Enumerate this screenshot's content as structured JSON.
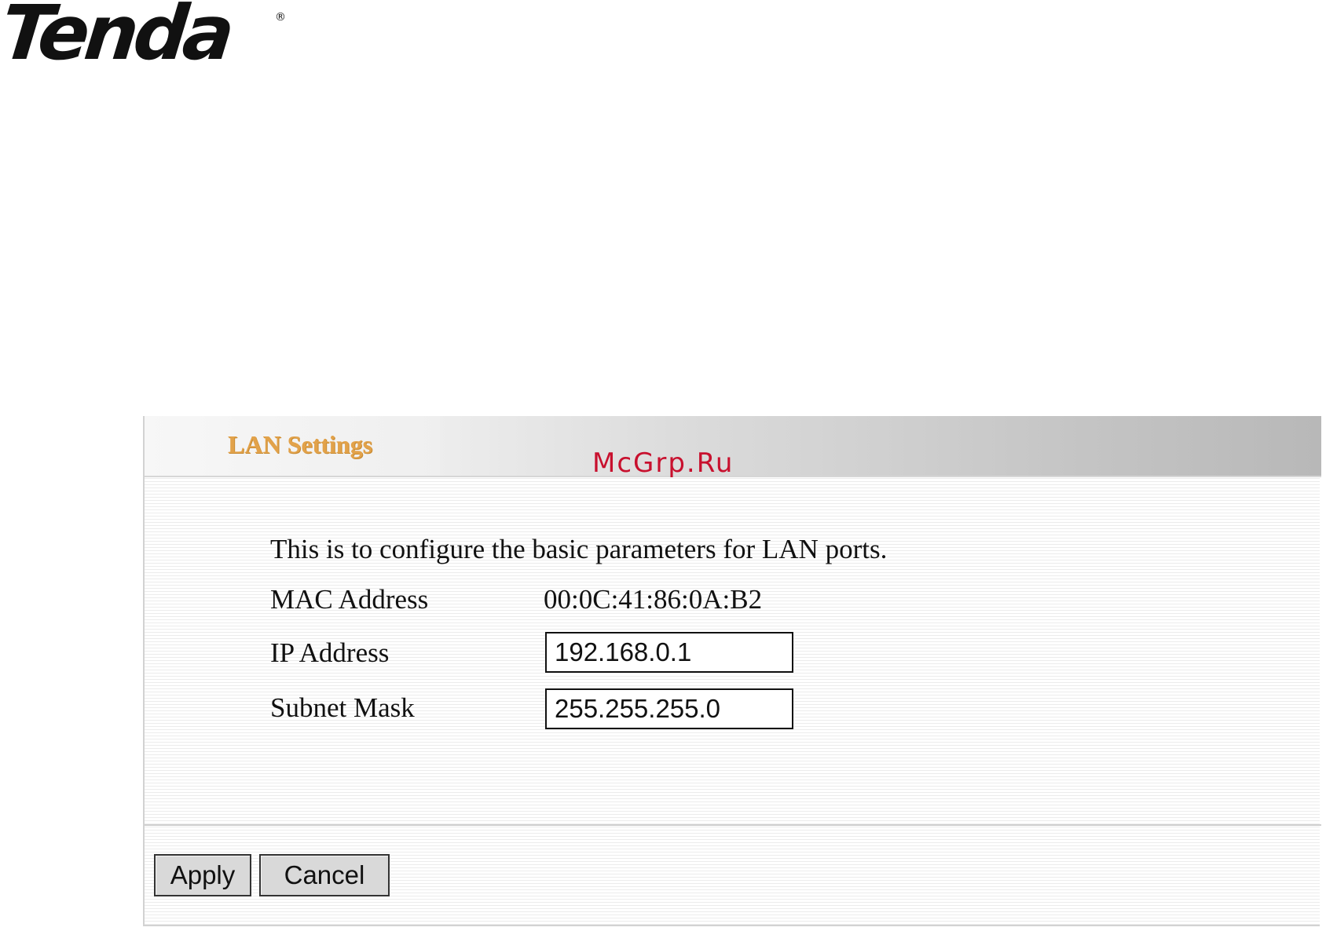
{
  "brand": {
    "logo_text": "Tenda",
    "registered_mark": "®"
  },
  "watermark": "McGrp.Ru",
  "panel": {
    "title": "LAN Settings",
    "description": "This is to configure the basic parameters for LAN ports.",
    "mac": {
      "label": "MAC Address",
      "value": "00:0C:41:86:0A:B2"
    },
    "ip": {
      "label": "IP Address",
      "value": "192.168.0.1"
    },
    "subnet": {
      "label": "Subnet Mask",
      "value": "255.255.255.0"
    }
  },
  "buttons": {
    "apply": "Apply",
    "cancel": "Cancel"
  },
  "colors": {
    "title": "#e2a24a",
    "watermark": "#c8102e"
  }
}
